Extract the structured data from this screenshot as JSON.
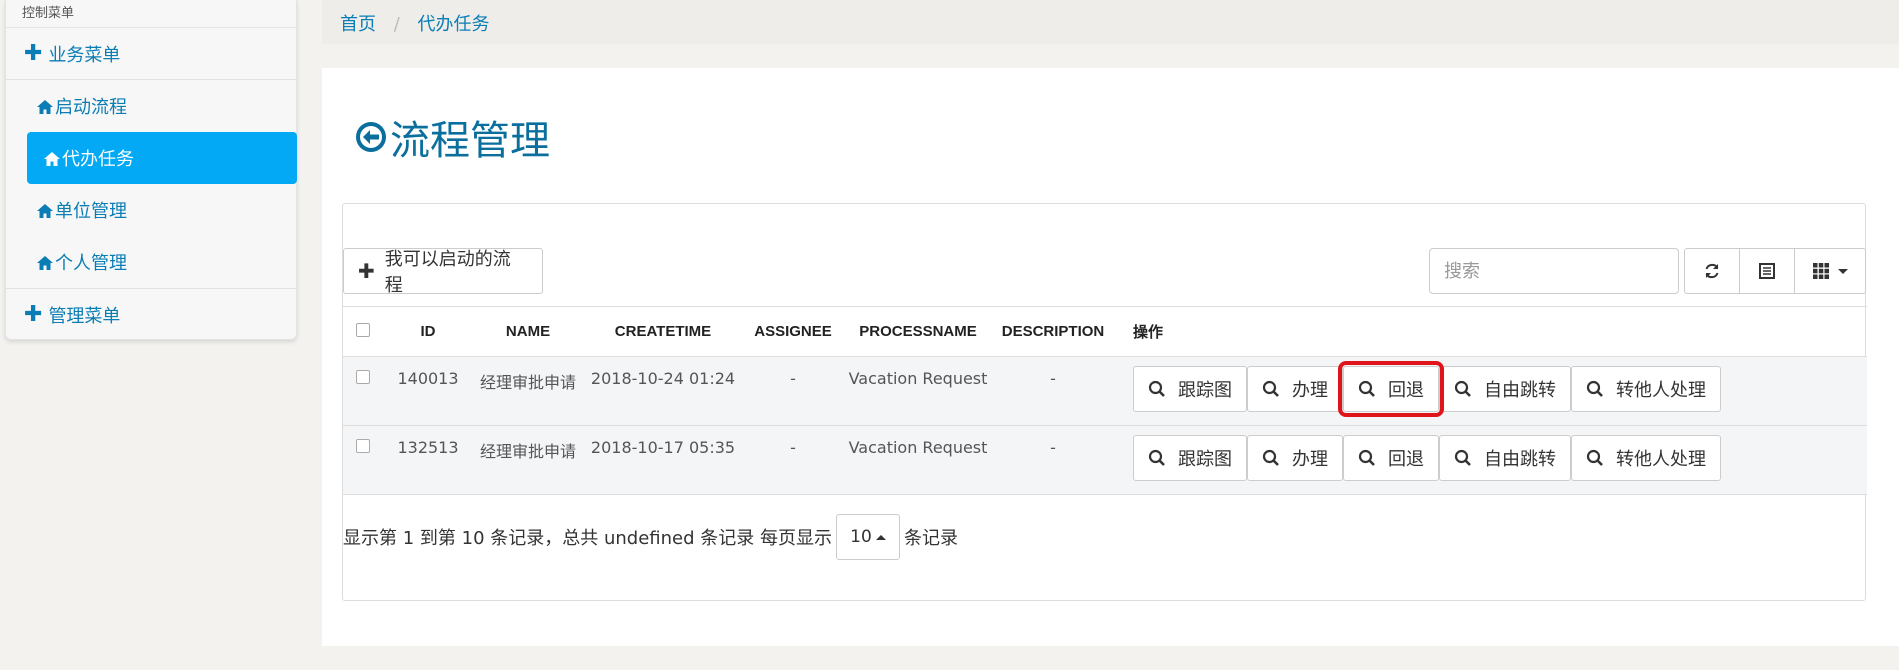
{
  "sidebar": {
    "header": "控制菜单",
    "groups": [
      {
        "label": "业务菜单"
      },
      {
        "label": "管理菜单"
      }
    ],
    "items": [
      {
        "label": "启动流程"
      },
      {
        "label": "代办任务"
      },
      {
        "label": "单位管理"
      },
      {
        "label": "个人管理"
      }
    ],
    "active_item": "代办任务"
  },
  "breadcrumb": {
    "items": [
      "首页",
      "代办任务"
    ],
    "separator": "/"
  },
  "page": {
    "title": "流程管理"
  },
  "toolbar": {
    "start_label": "我可以启动的流程",
    "search_placeholder": "搜索"
  },
  "table": {
    "columns": [
      "ID",
      "NAME",
      "CREATETIME",
      "ASSIGNEE",
      "PROCESSNAME",
      "DESCRIPTION",
      "操作"
    ],
    "rows": [
      {
        "id": "140013",
        "name": "经理审批申请",
        "createtime": "2018-10-24 01:24",
        "assignee": "-",
        "processname": "Vacation Request",
        "description": "-"
      },
      {
        "id": "132513",
        "name": "经理审批申请",
        "createtime": "2018-10-17 05:35",
        "assignee": "-",
        "processname": "Vacation Request",
        "description": "-"
      }
    ],
    "actions": [
      "跟踪图",
      "办理",
      "回退",
      "自由跳转",
      "转他人处理"
    ],
    "highlighted_action": "回退"
  },
  "pagination": {
    "prefix": "显示第 1 到第 10 条记录，总共 undefined 条记录 每页显示",
    "page_size": "10",
    "suffix": "条记录"
  },
  "colors": {
    "accent": "#03a9f4",
    "link": "#0b7db5",
    "highlight_border": "#e0141b"
  }
}
